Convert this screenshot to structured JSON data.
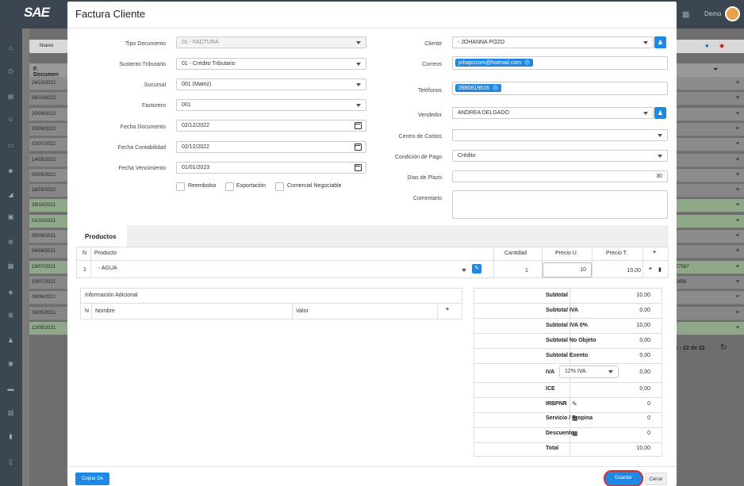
{
  "background": {
    "nuevo_label": "Nuevo",
    "column_header": "F. Documen",
    "dates": [
      "24/10/2022",
      "06/10/2022",
      "20/09/2022",
      "15/08/2022",
      "02/07/2022",
      "14/05/2022",
      "05/05/2022",
      "18/03/2022",
      "29/10/2021",
      "01/10/2021",
      "05/09/2021",
      "04/08/2021",
      "19/07/2021",
      "19/07/2021",
      "09/06/2021",
      "18/05/2021",
      "12/05/2021"
    ],
    "right_fragments": [
      "77587",
      "3456"
    ],
    "pagination": "1 - 22 de 22",
    "user_label": "Demo"
  },
  "modal": {
    "title": "Factura Cliente",
    "left_form": {
      "tipo_documento": {
        "label": "Tipo Documento",
        "value": "01 - FACTURA"
      },
      "sustento": {
        "label": "Sustento Tributario",
        "value": "01 - Crédito Tributario"
      },
      "sucursal": {
        "label": "Sucursal",
        "value": "001 (Matriz)"
      },
      "facturero": {
        "label": "Facturero",
        "value": "001"
      },
      "fecha_documento": {
        "label": "Fecha Documento",
        "value": "02/12/2022"
      },
      "fecha_contabilidad": {
        "label": "Fecha Contabilidad",
        "value": "02/12/2022"
      },
      "fecha_vencimiento": {
        "label": "Fecha Vencimiento",
        "value": "01/01/2023"
      },
      "reembolso": "Reembolso",
      "exportacion": "Exportación",
      "comercial": "Comercial Negociable"
    },
    "right_form": {
      "cliente": {
        "label": "Cliente",
        "value": "- JOHANNA POZO"
      },
      "correos": {
        "label": "Correos",
        "tag": "johapozom@hotmail.com"
      },
      "telefonos": {
        "label": "Teléfonos",
        "tag": "0980819616"
      },
      "vendedor": {
        "label": "Vendedor",
        "value": "ANDREA DELGADO"
      },
      "centro_costos": {
        "label": "Centro de Costos",
        "value": ""
      },
      "condicion_pago": {
        "label": "Condición de Pago",
        "value": "Crédito"
      },
      "dias_plazo": {
        "label": "Días de Plazo",
        "value": "30"
      },
      "comentario": {
        "label": "Comentario",
        "value": ""
      }
    },
    "products_tab": "Productos",
    "products_table": {
      "headers": {
        "n": "N",
        "producto": "Producto",
        "cantidad": "Cantidad",
        "precio_u": "Precio U.",
        "precio_t": "Precio T.",
        "add": "+"
      },
      "rows": [
        {
          "n": "1",
          "producto": "- AGUA",
          "cantidad": "1",
          "precio_u": "10",
          "precio_t": "10,00"
        }
      ]
    },
    "info_adicional": {
      "title": "Información Adicional",
      "headers": {
        "n": "N",
        "nombre": "Nombre",
        "valor": "Valor",
        "add": "+"
      }
    },
    "totals": {
      "subtotal": {
        "label": "Subtotal",
        "value": "10,00"
      },
      "subtotal_iva": {
        "label": "Subtotal IVA",
        "value": "0,00"
      },
      "subtotal_iva0": {
        "label": "Subtotal IVA 0%",
        "value": "10,00"
      },
      "subtotal_no_objeto": {
        "label": "Subtotal No Objeto",
        "value": "0,00"
      },
      "subtotal_exento": {
        "label": "Subtotal Exento",
        "value": "0,00"
      },
      "iva": {
        "label": "IVA",
        "select": "12% IVA",
        "value": "0,00"
      },
      "ice": {
        "label": "ICE",
        "value": "0,00"
      },
      "irbpnr": {
        "label": "IRBPNR",
        "value": "0"
      },
      "servicio": {
        "label": "Servicio / Propina",
        "value": "0"
      },
      "descuento": {
        "label": "Descuento",
        "value": "0"
      },
      "total": {
        "label": "Total",
        "value": "10,00"
      }
    },
    "buttons": {
      "copiar": "Copiar De",
      "guardar": "Guardar",
      "cerrar": "Cerrar"
    }
  }
}
